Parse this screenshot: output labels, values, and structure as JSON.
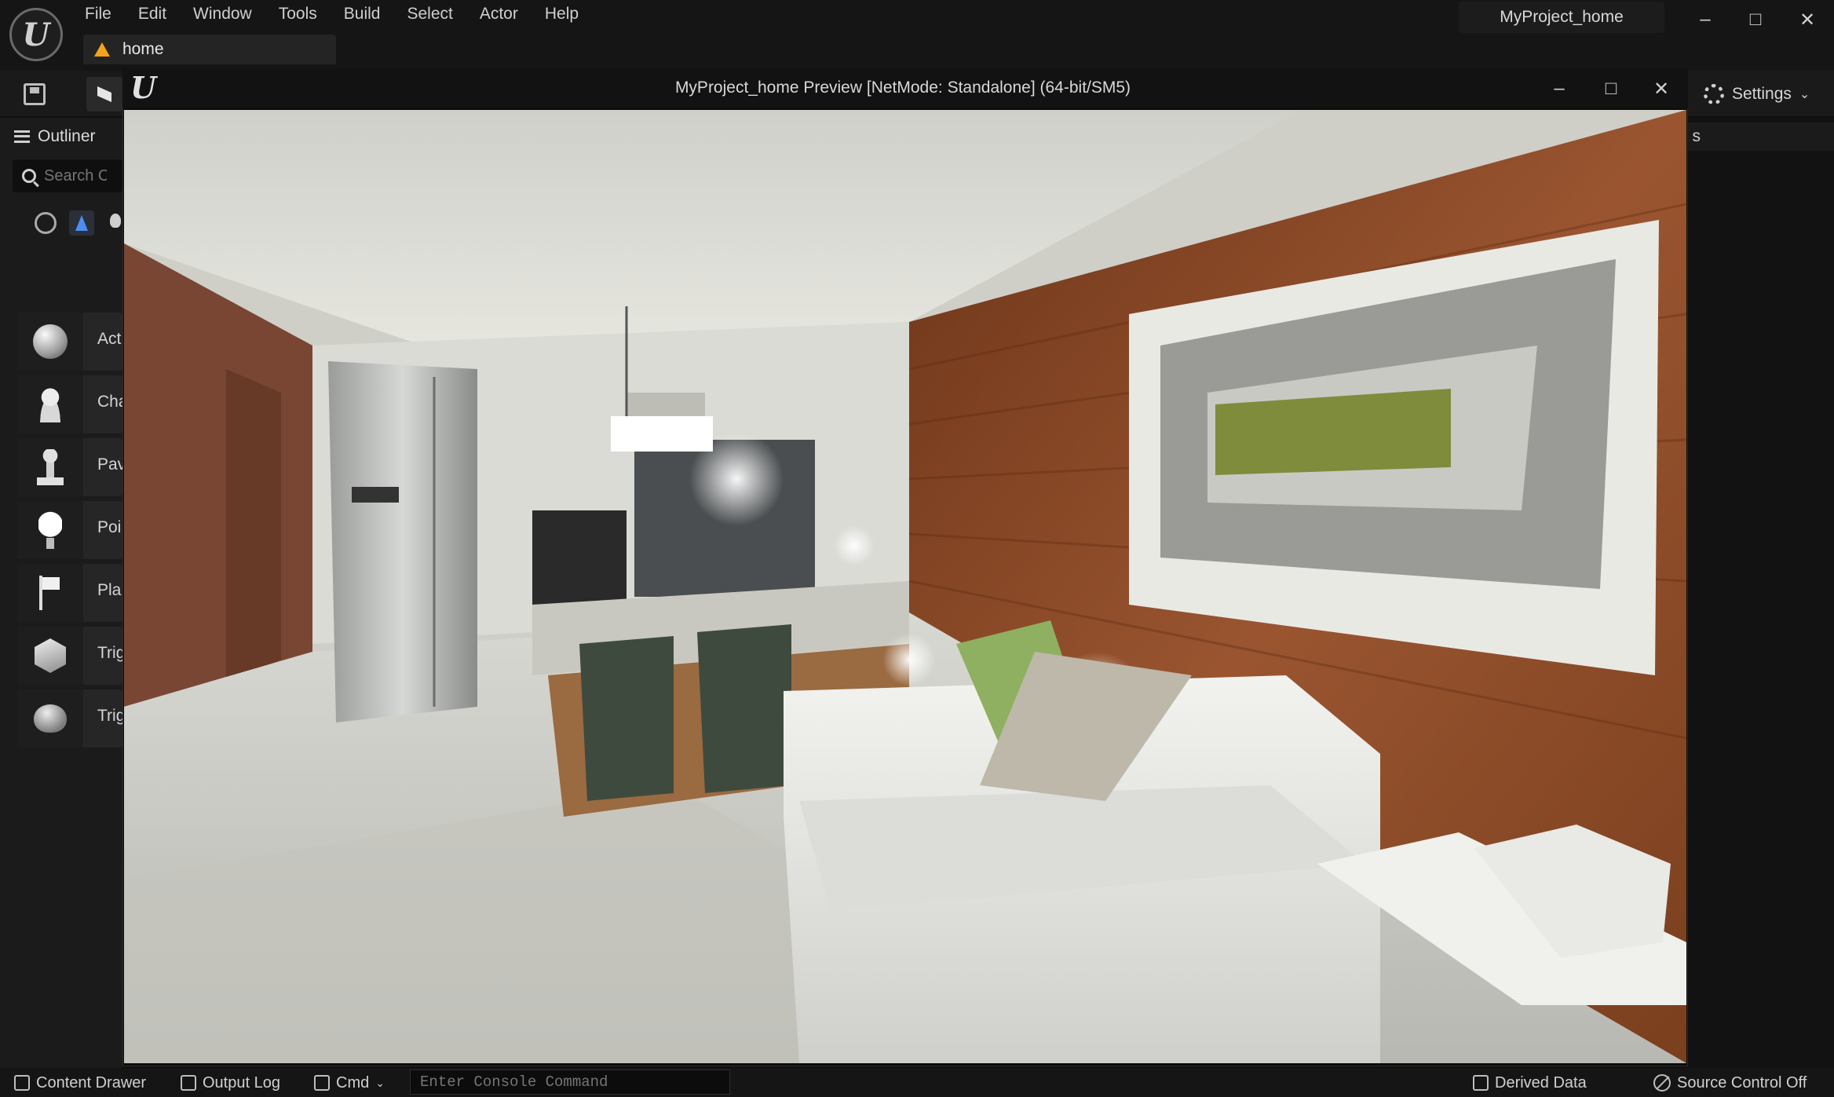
{
  "editor": {
    "menu": [
      "File",
      "Edit",
      "Window",
      "Tools",
      "Build",
      "Select",
      "Actor",
      "Help"
    ],
    "project_name": "MyProject_home",
    "level_tab": "home",
    "settings_label": "Settings"
  },
  "outliner": {
    "tab_label": "Outliner",
    "search_placeholder": "Search Cl",
    "place_items": [
      {
        "label": "Act"
      },
      {
        "label": "Cha"
      },
      {
        "label": "Pav"
      },
      {
        "label": "Poi"
      },
      {
        "label": "Pla"
      },
      {
        "label": "Trig"
      },
      {
        "label": "Trig"
      }
    ]
  },
  "right_panel": {
    "tab_fragment": "s"
  },
  "preview": {
    "title": "MyProject_home Preview [NetMode: Standalone]  (64-bit/SM5)"
  },
  "statusbar": {
    "content_drawer": "Content Drawer",
    "output_log": "Output Log",
    "cmd": "Cmd",
    "console_placeholder": "Enter Console Command",
    "derived_data": "Derived Data",
    "source_control": "Source Control Off"
  },
  "colors": {
    "accent_warning": "#f2a51a",
    "filter_active": "#4d8ef0",
    "wood_wall": "#8a4a28",
    "artwork_green": "#7f8c3c"
  }
}
